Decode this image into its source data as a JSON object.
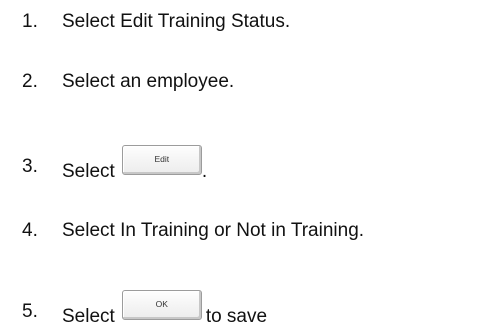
{
  "steps": [
    {
      "number": "1.",
      "text": "Select Edit Training Status."
    },
    {
      "number": "2.",
      "text": "Select an employee."
    },
    {
      "number": "3.",
      "text": "Select",
      "button_label": "Edit",
      "after": "."
    },
    {
      "number": "4.",
      "text": "Select In Training or Not in Training."
    },
    {
      "number": "5.",
      "text": "Select",
      "button_label": "OK",
      "after": "to save"
    }
  ]
}
